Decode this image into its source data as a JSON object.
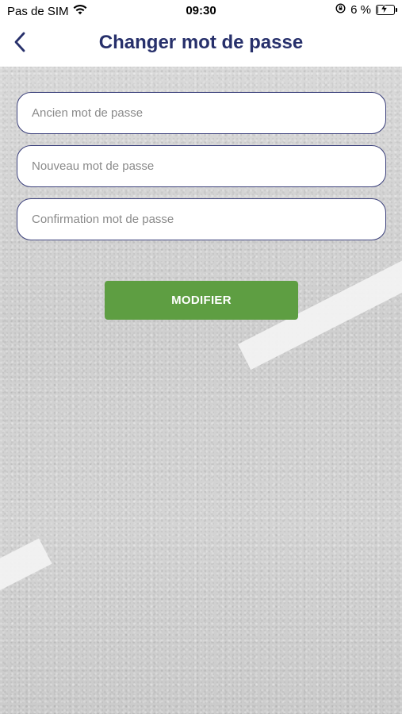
{
  "status_bar": {
    "carrier": "Pas de SIM",
    "time": "09:30",
    "battery_percent": "6 %",
    "battery_level": 0.06,
    "icons": [
      "wifi-icon",
      "orientation-lock-icon",
      "battery-icon",
      "charging-bolt-icon"
    ]
  },
  "header": {
    "back_icon": "chevron-left-icon",
    "title": "Changer mot de passe"
  },
  "form": {
    "old_password": {
      "placeholder": "Ancien mot de passe",
      "value": ""
    },
    "new_password": {
      "placeholder": "Nouveau mot de passe",
      "value": ""
    },
    "confirm_password": {
      "placeholder": "Confirmation mot de passe",
      "value": ""
    },
    "submit_label": "MODIFIER"
  },
  "colors": {
    "title": "#27306b",
    "field_border": "#3a3f7a",
    "submit_button": "#5e9e42",
    "background": "#d2d2d2"
  }
}
